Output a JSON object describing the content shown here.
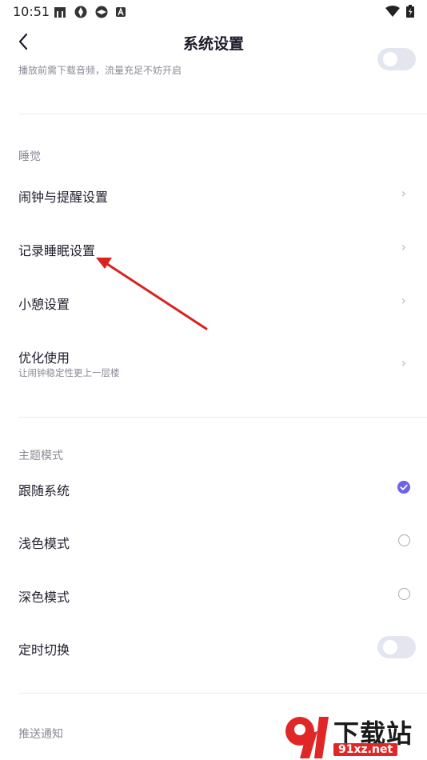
{
  "status_bar": {
    "time": "10:51",
    "left_icons": [
      "notification-a-icon",
      "notification-b-icon",
      "notification-c-icon",
      "notification-d-icon"
    ],
    "right_icons": [
      "wifi-icon",
      "battery-icon"
    ]
  },
  "header": {
    "title": "系统设置",
    "back_icon": "back-chevron-icon"
  },
  "top_partial": {
    "subtitle": "播放前需下载音频，流量充足不妨开启",
    "toggle_on": false
  },
  "sleep_section": {
    "label": "睡觉",
    "items": [
      {
        "title": "闹钟与提醒设置",
        "subtitle": ""
      },
      {
        "title": "记录睡眠设置",
        "subtitle": ""
      },
      {
        "title": "小憩设置",
        "subtitle": ""
      },
      {
        "title": "优化使用",
        "subtitle": "让闹钟稳定性更上一层楼"
      }
    ],
    "chevron": "›"
  },
  "theme_section": {
    "label": "主题模式",
    "options": [
      {
        "title": "跟随系统",
        "selected": true
      },
      {
        "title": "浅色模式",
        "selected": false
      },
      {
        "title": "深色模式",
        "selected": false
      }
    ],
    "timed_switch": {
      "title": "定时切换",
      "toggle_on": false
    }
  },
  "push_section": {
    "label": "推送通知"
  },
  "watermark": {
    "title": "下载站",
    "url": "91xz.net"
  },
  "colors": {
    "accent": "#6c63e8",
    "annotation_arrow": "#d9231f",
    "watermark_red": "#e02727"
  }
}
